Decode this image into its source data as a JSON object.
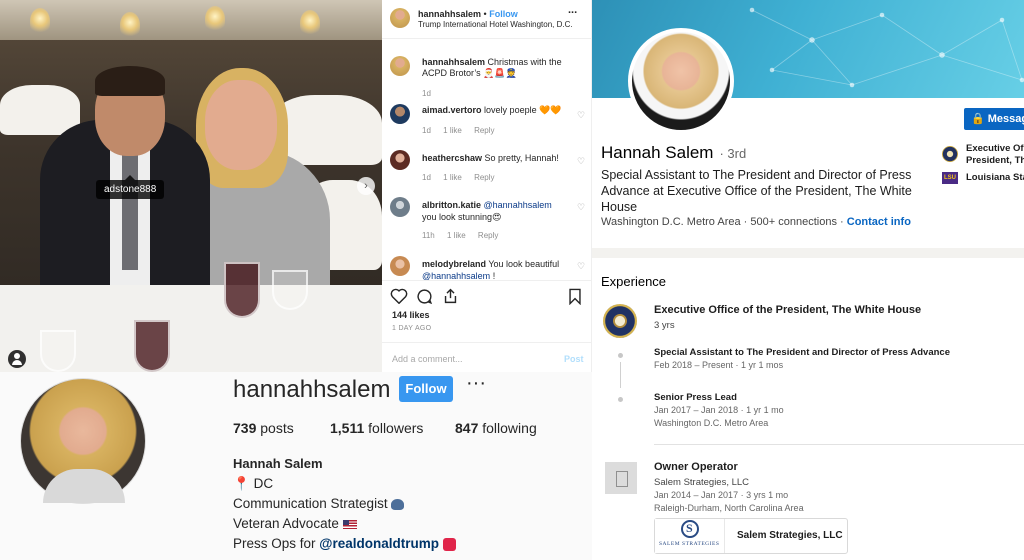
{
  "instagram_post": {
    "photo_tag": "adstone888",
    "header": {
      "username": "hannahhsalem",
      "separator": "•",
      "follow_label": "Follow",
      "location": "Trump International Hotel Washington, D.C.",
      "more_label": "..."
    },
    "caption": {
      "username": "hannahhsalem",
      "text_line1": "Christmas with the",
      "text_line2": "ACPD Brotor’s 🎅🚨👮",
      "age": "1d"
    },
    "comments": [
      {
        "username": "aimad.vertoro",
        "text": "lovely poeple 🧡🧡",
        "age": "1d",
        "likes": "1 like",
        "reply": "Reply"
      },
      {
        "username": "heathercshaw",
        "text": "So pretty, Hannah!",
        "age": "1d",
        "likes": "1 like",
        "reply": "Reply"
      },
      {
        "username": "albritton.katie",
        "mention": "@hannahhsalem",
        "text": "you look stunning😍",
        "age": "11h",
        "likes": "1 like",
        "reply": "Reply"
      },
      {
        "username": "melodybreland",
        "text": "You look beautiful",
        "mention": "@hannahhsalem",
        "text_after": "!"
      }
    ],
    "likes": "144 likes",
    "timestamp": "1 DAY AGO",
    "add_comment_placeholder": "Add a comment...",
    "post_label": "Post",
    "icons": [
      "heart-icon",
      "comment-icon",
      "share-icon",
      "bookmark-icon"
    ]
  },
  "instagram_profile": {
    "username": "hannahhsalem",
    "follow_label": "Follow",
    "more_label": "···",
    "stats": {
      "posts_count": "739",
      "posts_label": "posts",
      "followers_count": "1,511",
      "followers_label": "followers",
      "following_count": "847",
      "following_label": "following"
    },
    "full_name": "Hannah Salem",
    "bio": {
      "line1": "DC",
      "line2": "Communication Strategist",
      "line3": "Veteran Advocate",
      "line4_prefix": "Press Ops for",
      "line4_mention": "@realdonaldtrump"
    },
    "accent_color": "#3897f0"
  },
  "linkedin": {
    "name": "Hannah Salem",
    "degree": "· 3rd",
    "headline": "Special Assistant to The President and Director of Press Advance at Executive Office of the President, The White House",
    "location": "Washington D.C. Metro Area",
    "connections": "500+ connections",
    "contact_info": "Contact info",
    "message_label": "Messag",
    "side_items": [
      {
        "line1": "Executive Of",
        "line2": "President, Th"
      },
      {
        "line1": "Louisiana Sta",
        "logo_text": "LSU"
      }
    ],
    "experience": {
      "heading": "Experience",
      "groups": [
        {
          "company": "Executive Office of the President, The White House",
          "duration": "3 yrs",
          "roles": [
            {
              "title": "Special Assistant to The President and Director of Press Advance",
              "dates": "Feb 2018 – Present · 1 yr 1 mos"
            },
            {
              "title": "Senior Press Lead",
              "dates": "Jan 2017 – Jan 2018 · 1 yr 1 mo",
              "location": "Washington D.C. Metro Area"
            }
          ]
        },
        {
          "title": "Owner Operator",
          "company": "Salem Strategies, LLC",
          "dates": "Jan 2014 – Jan 2017 · 3 yrs 1 mo",
          "location": "Raleigh-Durham, North Carolina Area",
          "media_caption": "SALEM STRATEGIES",
          "media_title": "Salem Strategies, LLC"
        }
      ]
    },
    "brand_color": "#0a66c2"
  }
}
